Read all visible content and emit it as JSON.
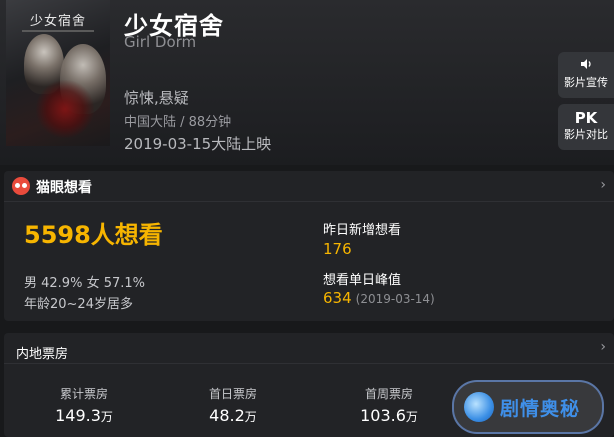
{
  "movie": {
    "title_cn": "少女宿舍",
    "title_en": "Girl Dorm",
    "genre": "惊悚,悬疑",
    "origin": "中国大陆 / 88分钟",
    "release": "2019-03-15大陆上映",
    "poster_title": "少女宿舍"
  },
  "side_buttons": {
    "promo_icon": "speaker-icon",
    "promo_label": "影片宣传",
    "pk_text": "PK",
    "pk_label": "影片对比"
  },
  "maoyan": {
    "title": "猫眼想看",
    "want_total": "5598人想看",
    "gender": "男 42.9% 女 57.1%",
    "age": "年龄20~24岁居多",
    "yesterday_label": "昨日新增想看",
    "yesterday_value": "176",
    "peak_label": "想看单日峰值",
    "peak_value": "634",
    "peak_date": "(2019-03-14)"
  },
  "box_office": {
    "title": "内地票房",
    "items": [
      {
        "label": "累计票房",
        "value": "149.3",
        "unit": "万"
      },
      {
        "label": "首日票房",
        "value": "48.2",
        "unit": "万"
      },
      {
        "label": "首周票房",
        "value": "103.6",
        "unit": "万"
      }
    ]
  },
  "watermark": {
    "text": "剧情奥秘"
  },
  "colors": {
    "accent": "#f7b500",
    "background": "#18191b",
    "card": "#222326",
    "maoyan_red": "#e94b3c"
  }
}
